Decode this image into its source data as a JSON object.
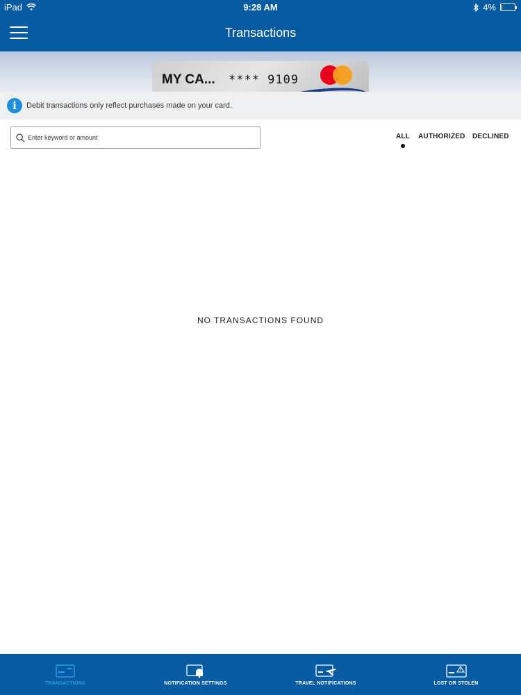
{
  "status_bar": {
    "device": "iPad",
    "time": "9:28 AM",
    "battery": "4%",
    "battery_level": 0.04
  },
  "nav": {
    "title": "Transactions"
  },
  "card": {
    "name": "MY CA...",
    "number_masked": "**** 9109"
  },
  "info": {
    "text": "Debit transactions only reflect purchases made on your card."
  },
  "search": {
    "placeholder": "Enter keyword or amount",
    "value": ""
  },
  "filters": {
    "all": "ALL",
    "authorized": "AUTHORIZED",
    "declined": "DECLINED",
    "selected": "ALL"
  },
  "empty_state": {
    "message": "NO TRANSACTIONS FOUND"
  },
  "tabbar": {
    "transactions": "TRANSACTIONS",
    "notification_settings": "NOTIFICATION SETTINGS",
    "travel_notifications": "TRAVEL NOTIFICATIONS",
    "lost_or_stolen": "LOST OR STOLEN",
    "active": "TRANSACTIONS"
  },
  "colors": {
    "primary": "#075ba2",
    "active_tab": "#2e9be6",
    "info_icon": "#1d8fdc"
  }
}
